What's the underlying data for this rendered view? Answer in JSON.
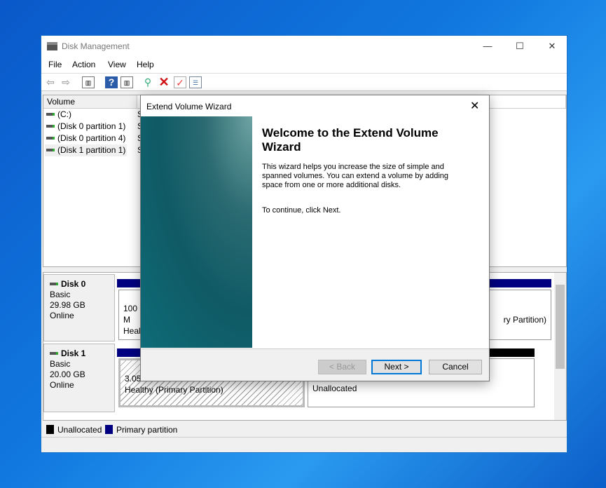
{
  "window": {
    "title": "Disk Management",
    "controls": [
      "—",
      "☐",
      "✕"
    ]
  },
  "menu": [
    "File",
    "Action",
    "View",
    "Help"
  ],
  "toolbar": {
    "icons": [
      "back-icon",
      "forward-icon",
      "console-tree-icon",
      "help-icon",
      "properties-icon",
      "connect-icon",
      "delete-icon",
      "check-icon",
      "list-icon"
    ]
  },
  "list": {
    "columns": [
      "Volume",
      "L"
    ],
    "rows": [
      {
        "volume": "(C:)",
        "l": "S"
      },
      {
        "volume": "(Disk 0 partition 1)",
        "l": "S"
      },
      {
        "volume": "(Disk 0 partition 4)",
        "l": "S"
      },
      {
        "volume": "(Disk 1 partition 1)",
        "l": "S"
      }
    ]
  },
  "disks": [
    {
      "name": "Disk 0",
      "type": "Basic",
      "size": "29.98 GB",
      "status": "Online",
      "partitions": [
        {
          "line1": "100 M",
          "line2": "Healt"
        },
        {
          "line1": "",
          "line2": "ry Partition)"
        }
      ]
    },
    {
      "name": "Disk 1",
      "type": "Basic",
      "size": "20.00 GB",
      "status": "Online",
      "partitions": [
        {
          "line1": "3.05 G",
          "line2": "Healthy (Primary Partition)"
        },
        {
          "line1": "",
          "line2": "Unallocated"
        }
      ]
    }
  ],
  "legend": [
    {
      "label": "Unallocated",
      "color": "#000000"
    },
    {
      "label": "Primary partition",
      "color": "#000080"
    }
  ],
  "dialog": {
    "title": "Extend Volume Wizard",
    "heading": "Welcome to the Extend Volume Wizard",
    "body": "This wizard helps you increase the size of simple and spanned volumes. You can extend a volume  by adding space from one or more additional disks.",
    "continue": "To continue, click Next.",
    "back": "< Back",
    "next": "Next >",
    "cancel": "Cancel",
    "close": "✕"
  }
}
